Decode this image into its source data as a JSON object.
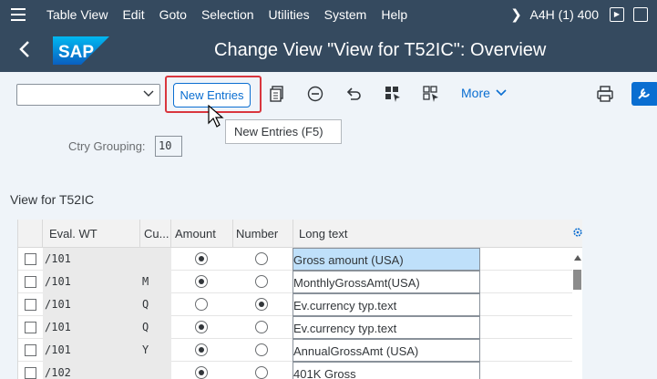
{
  "menubar": {
    "items": [
      "Table View",
      "Edit",
      "Goto",
      "Selection",
      "Utilities",
      "System",
      "Help"
    ],
    "system_info": "A4H (1) 400"
  },
  "titlebar": {
    "logo_text": "SAP",
    "title": "Change View \"View for T52IC\": Overview"
  },
  "toolbar": {
    "new_entries_label": "New Entries",
    "more_label": "More",
    "tooltip": "New Entries   (F5)"
  },
  "filter": {
    "ctry_label": "Ctry Grouping:",
    "ctry_value": "10"
  },
  "section_title": "View for T52IC",
  "table": {
    "columns": [
      "Eval. WT",
      "Cu...",
      "Amount",
      "Number",
      "Long text"
    ],
    "rows": [
      {
        "eval_wt": "/101",
        "cu": "",
        "amount": true,
        "number": false,
        "long_text": "Gross amount (USA)",
        "selected": true
      },
      {
        "eval_wt": "/101",
        "cu": "M",
        "amount": true,
        "number": false,
        "long_text": "MonthlyGrossAmt(USA)",
        "selected": false
      },
      {
        "eval_wt": "/101",
        "cu": "Q",
        "amount": false,
        "number": true,
        "long_text": "Ev.currency typ.text",
        "selected": false
      },
      {
        "eval_wt": "/101",
        "cu": "Q",
        "amount": true,
        "number": false,
        "long_text": "Ev.currency typ.text",
        "selected": false
      },
      {
        "eval_wt": "/101",
        "cu": "Y",
        "amount": true,
        "number": false,
        "long_text": "AnnualGrossAmt (USA)",
        "selected": false
      },
      {
        "eval_wt": "/102",
        "cu": "",
        "amount": true,
        "number": false,
        "long_text": "401K Gross",
        "selected": false
      }
    ]
  },
  "colors": {
    "shell": "#354a5f",
    "accent": "#0a6ed1",
    "highlight": "#d9363e",
    "selected_cell": "#bfe0fa"
  }
}
